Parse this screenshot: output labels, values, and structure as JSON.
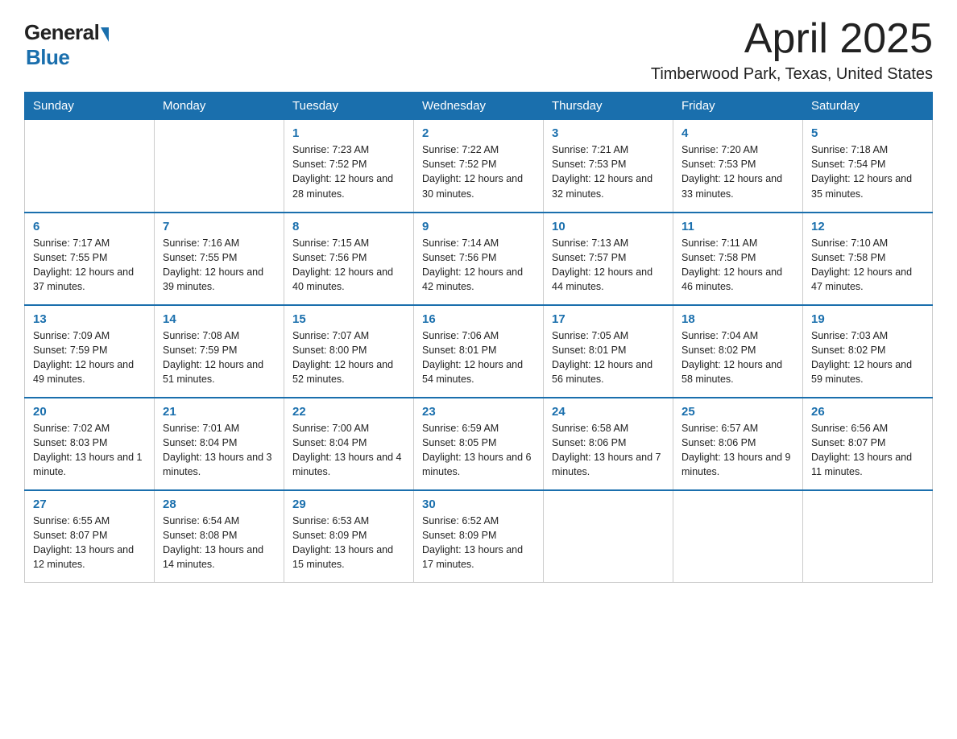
{
  "logo": {
    "general": "General",
    "blue": "Blue"
  },
  "title": "April 2025",
  "location": "Timberwood Park, Texas, United States",
  "days_header": [
    "Sunday",
    "Monday",
    "Tuesday",
    "Wednesday",
    "Thursday",
    "Friday",
    "Saturday"
  ],
  "weeks": [
    [
      {
        "day": "",
        "info": ""
      },
      {
        "day": "",
        "info": ""
      },
      {
        "day": "1",
        "info": "Sunrise: 7:23 AM\nSunset: 7:52 PM\nDaylight: 12 hours and 28 minutes."
      },
      {
        "day": "2",
        "info": "Sunrise: 7:22 AM\nSunset: 7:52 PM\nDaylight: 12 hours and 30 minutes."
      },
      {
        "day": "3",
        "info": "Sunrise: 7:21 AM\nSunset: 7:53 PM\nDaylight: 12 hours and 32 minutes."
      },
      {
        "day": "4",
        "info": "Sunrise: 7:20 AM\nSunset: 7:53 PM\nDaylight: 12 hours and 33 minutes."
      },
      {
        "day": "5",
        "info": "Sunrise: 7:18 AM\nSunset: 7:54 PM\nDaylight: 12 hours and 35 minutes."
      }
    ],
    [
      {
        "day": "6",
        "info": "Sunrise: 7:17 AM\nSunset: 7:55 PM\nDaylight: 12 hours and 37 minutes."
      },
      {
        "day": "7",
        "info": "Sunrise: 7:16 AM\nSunset: 7:55 PM\nDaylight: 12 hours and 39 minutes."
      },
      {
        "day": "8",
        "info": "Sunrise: 7:15 AM\nSunset: 7:56 PM\nDaylight: 12 hours and 40 minutes."
      },
      {
        "day": "9",
        "info": "Sunrise: 7:14 AM\nSunset: 7:56 PM\nDaylight: 12 hours and 42 minutes."
      },
      {
        "day": "10",
        "info": "Sunrise: 7:13 AM\nSunset: 7:57 PM\nDaylight: 12 hours and 44 minutes."
      },
      {
        "day": "11",
        "info": "Sunrise: 7:11 AM\nSunset: 7:58 PM\nDaylight: 12 hours and 46 minutes."
      },
      {
        "day": "12",
        "info": "Sunrise: 7:10 AM\nSunset: 7:58 PM\nDaylight: 12 hours and 47 minutes."
      }
    ],
    [
      {
        "day": "13",
        "info": "Sunrise: 7:09 AM\nSunset: 7:59 PM\nDaylight: 12 hours and 49 minutes."
      },
      {
        "day": "14",
        "info": "Sunrise: 7:08 AM\nSunset: 7:59 PM\nDaylight: 12 hours and 51 minutes."
      },
      {
        "day": "15",
        "info": "Sunrise: 7:07 AM\nSunset: 8:00 PM\nDaylight: 12 hours and 52 minutes."
      },
      {
        "day": "16",
        "info": "Sunrise: 7:06 AM\nSunset: 8:01 PM\nDaylight: 12 hours and 54 minutes."
      },
      {
        "day": "17",
        "info": "Sunrise: 7:05 AM\nSunset: 8:01 PM\nDaylight: 12 hours and 56 minutes."
      },
      {
        "day": "18",
        "info": "Sunrise: 7:04 AM\nSunset: 8:02 PM\nDaylight: 12 hours and 58 minutes."
      },
      {
        "day": "19",
        "info": "Sunrise: 7:03 AM\nSunset: 8:02 PM\nDaylight: 12 hours and 59 minutes."
      }
    ],
    [
      {
        "day": "20",
        "info": "Sunrise: 7:02 AM\nSunset: 8:03 PM\nDaylight: 13 hours and 1 minute."
      },
      {
        "day": "21",
        "info": "Sunrise: 7:01 AM\nSunset: 8:04 PM\nDaylight: 13 hours and 3 minutes."
      },
      {
        "day": "22",
        "info": "Sunrise: 7:00 AM\nSunset: 8:04 PM\nDaylight: 13 hours and 4 minutes."
      },
      {
        "day": "23",
        "info": "Sunrise: 6:59 AM\nSunset: 8:05 PM\nDaylight: 13 hours and 6 minutes."
      },
      {
        "day": "24",
        "info": "Sunrise: 6:58 AM\nSunset: 8:06 PM\nDaylight: 13 hours and 7 minutes."
      },
      {
        "day": "25",
        "info": "Sunrise: 6:57 AM\nSunset: 8:06 PM\nDaylight: 13 hours and 9 minutes."
      },
      {
        "day": "26",
        "info": "Sunrise: 6:56 AM\nSunset: 8:07 PM\nDaylight: 13 hours and 11 minutes."
      }
    ],
    [
      {
        "day": "27",
        "info": "Sunrise: 6:55 AM\nSunset: 8:07 PM\nDaylight: 13 hours and 12 minutes."
      },
      {
        "day": "28",
        "info": "Sunrise: 6:54 AM\nSunset: 8:08 PM\nDaylight: 13 hours and 14 minutes."
      },
      {
        "day": "29",
        "info": "Sunrise: 6:53 AM\nSunset: 8:09 PM\nDaylight: 13 hours and 15 minutes."
      },
      {
        "day": "30",
        "info": "Sunrise: 6:52 AM\nSunset: 8:09 PM\nDaylight: 13 hours and 17 minutes."
      },
      {
        "day": "",
        "info": ""
      },
      {
        "day": "",
        "info": ""
      },
      {
        "day": "",
        "info": ""
      }
    ]
  ]
}
